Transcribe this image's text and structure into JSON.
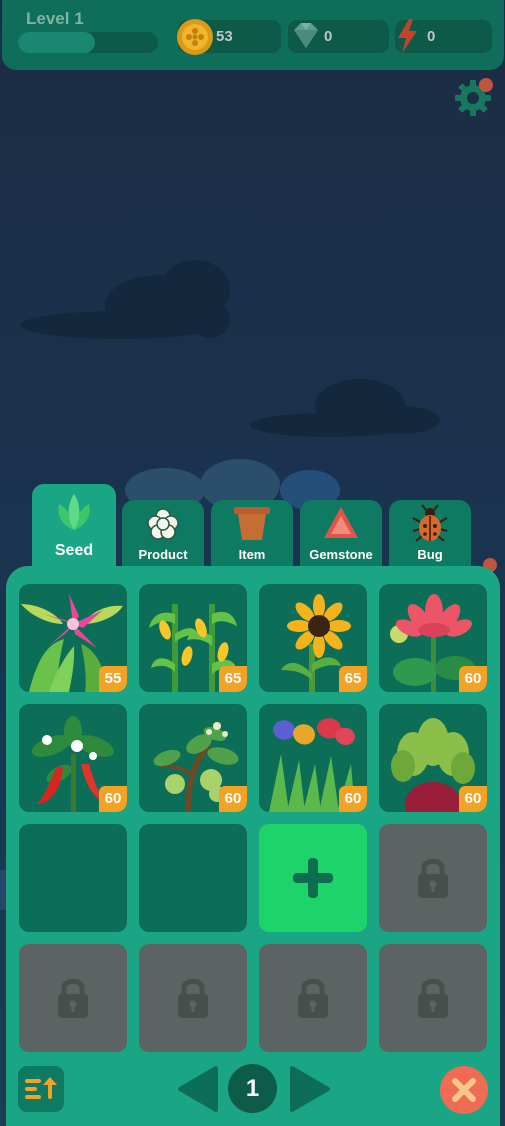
{
  "hud": {
    "level_label": "Level 1",
    "xp_progress": 0.55,
    "coins": "53",
    "gems": "0",
    "energy": "0"
  },
  "icons": {
    "coin": "coin-icon",
    "gem": "diamond-icon",
    "energy": "lightning-icon",
    "settings": "gear-icon",
    "lock": "lock-icon",
    "add": "plus-icon",
    "sort": "sort-icon",
    "close": "close-icon"
  },
  "tabs": [
    {
      "label": "Seed",
      "active": true
    },
    {
      "label": "Product",
      "active": false
    },
    {
      "label": "Item",
      "active": false
    },
    {
      "label": "Gemstone",
      "active": false
    },
    {
      "label": "Bug",
      "active": false
    }
  ],
  "slots": [
    {
      "plant": "lily",
      "count": "55"
    },
    {
      "plant": "corn",
      "count": "65"
    },
    {
      "plant": "sunflower",
      "count": "65"
    },
    {
      "plant": "lotus",
      "count": "60"
    },
    {
      "plant": "chili pepper",
      "count": "60"
    },
    {
      "plant": "hop plant",
      "count": "60"
    },
    {
      "plant": "tulips",
      "count": "60"
    },
    {
      "plant": "beetroot",
      "count": "60"
    }
  ],
  "pager": {
    "page": "1"
  },
  "colors": {
    "panel": "#1aa585",
    "badge": "#f2a326",
    "add_slot": "#1ed46a",
    "close": "#ef6b54"
  }
}
